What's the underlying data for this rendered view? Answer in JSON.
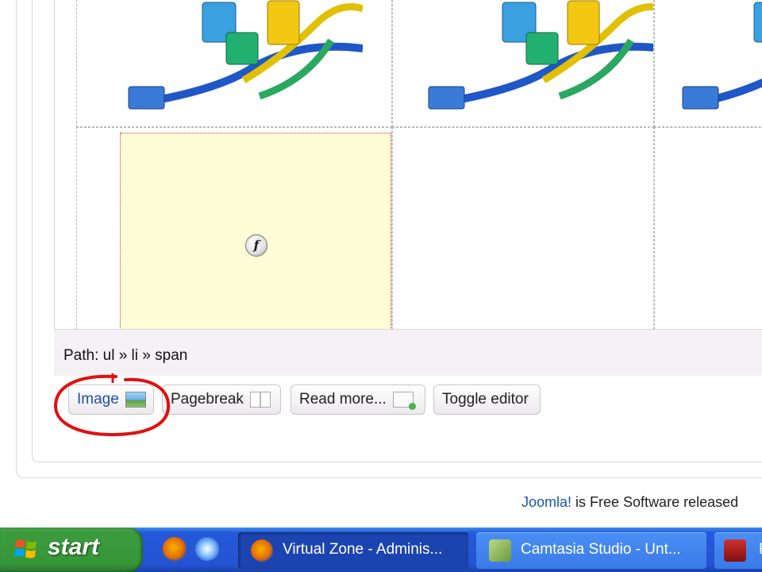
{
  "editor": {
    "path_label": "Path: ul » li » span"
  },
  "buttons": {
    "image": "Image",
    "pagebreak": "Pagebreak",
    "readmore": "Read more...",
    "toggle": "Toggle editor"
  },
  "footer": {
    "link": "Joomla!",
    "text": " is Free Software released"
  },
  "taskbar": {
    "start_label": "start",
    "tasks": [
      {
        "label": "Virtual Zone - Adminis...",
        "icon": "firefox-icon"
      },
      {
        "label": "Camtasia Studio - Unt...",
        "icon": "camtasia-icon"
      },
      {
        "label": "R",
        "icon": "recorder-icon"
      }
    ],
    "quicklaunch": [
      "firefox-icon",
      "ie-icon"
    ]
  },
  "colors": {
    "annotation": "#e01010",
    "placeholder_bg": "#fffdd6",
    "taskbar": "#2453d2",
    "start": "#3c9b3c"
  }
}
